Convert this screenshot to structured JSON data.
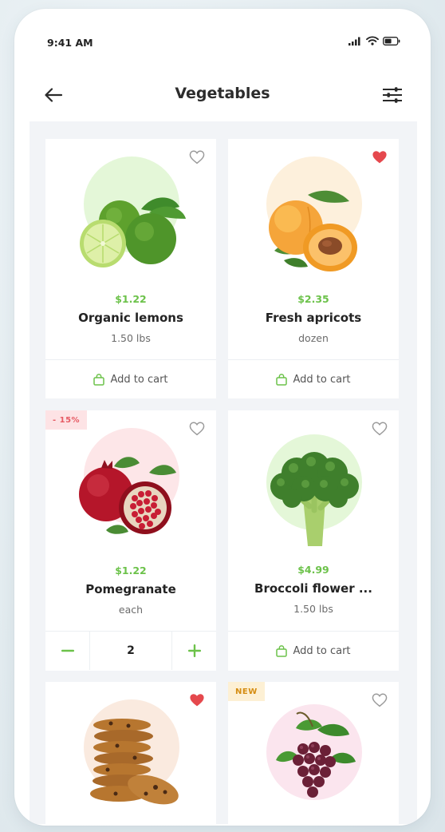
{
  "status_bar": {
    "time": "9:41 AM"
  },
  "header": {
    "title": "Vegetables"
  },
  "products": [
    {
      "price": "$1.22",
      "name": "Organic lemons",
      "unit": "1.50 lbs",
      "favorite": false,
      "action": "Add to cart",
      "circle_color": "#e4f7d8"
    },
    {
      "price": "$2.35",
      "name": "Fresh apricots",
      "unit": "dozen",
      "favorite": true,
      "action": "Add to cart",
      "circle_color": "#fdf0dc"
    },
    {
      "price": "$1.22",
      "name": "Pomegranate",
      "unit": "each",
      "favorite": false,
      "badge": "- 15%",
      "quantity": "2",
      "minus": "−",
      "plus": "+",
      "circle_color": "#fde6e8"
    },
    {
      "price": "$4.99",
      "name": "Broccoli flower ...",
      "unit": "1.50 lbs",
      "favorite": false,
      "action": "Add to cart",
      "circle_color": "#e4f7d8"
    },
    {
      "favorite": true,
      "circle_color": "#faeadf"
    },
    {
      "favorite": false,
      "badge": "NEW",
      "circle_color": "#fbe5ee"
    }
  ],
  "colors": {
    "accent_green": "#6cc24a",
    "favorite_red": "#e5484d",
    "title_text": "#2c2c2c"
  }
}
